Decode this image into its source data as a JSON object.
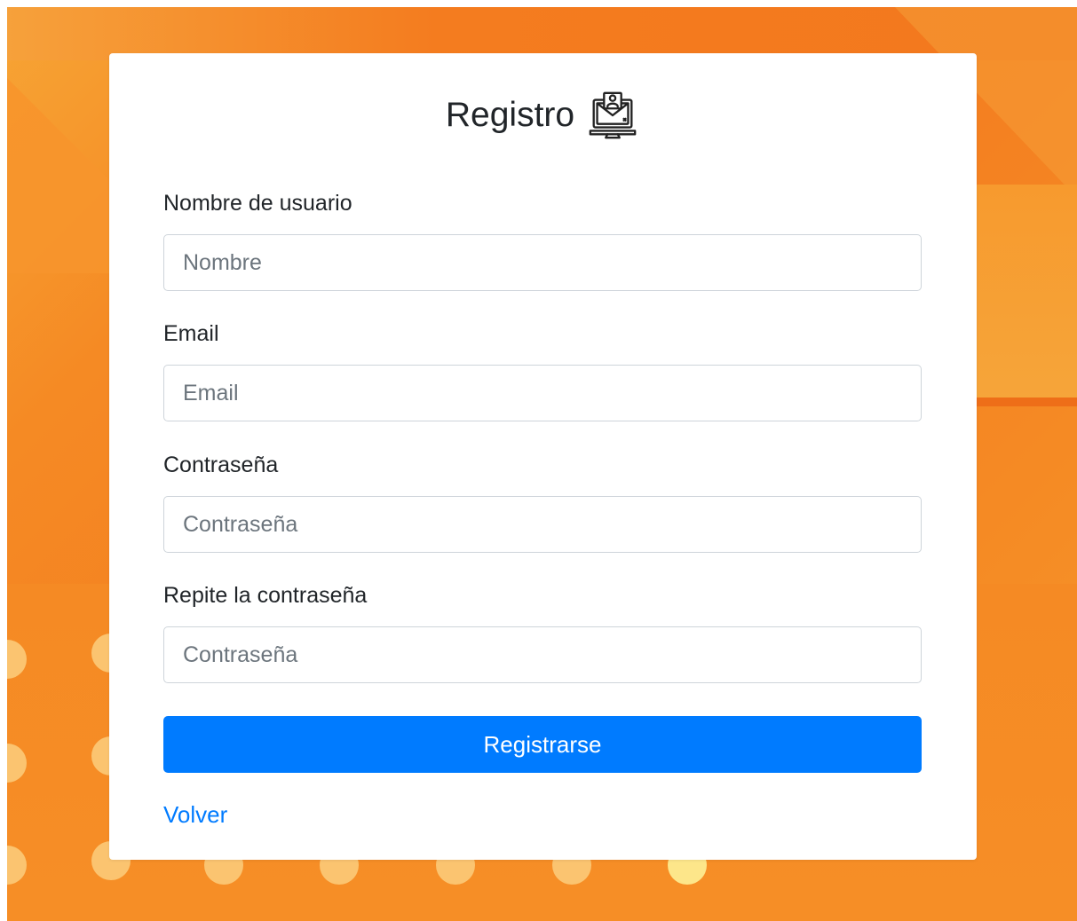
{
  "form": {
    "title": "Registro",
    "title_icon": "laptop-user-icon",
    "fields": [
      {
        "label": "Nombre de usuario",
        "placeholder": "Nombre",
        "value": ""
      },
      {
        "label": "Email",
        "placeholder": "Email",
        "value": ""
      },
      {
        "label": "Contraseña",
        "placeholder": "Contraseña",
        "value": ""
      },
      {
        "label": "Repite la contraseña",
        "placeholder": "Contraseña",
        "value": ""
      }
    ],
    "submit_label": "Registrarse",
    "back_link": "Volver"
  },
  "colors": {
    "background": "#f58a24",
    "accent": "#007bff",
    "card": "#ffffff"
  }
}
